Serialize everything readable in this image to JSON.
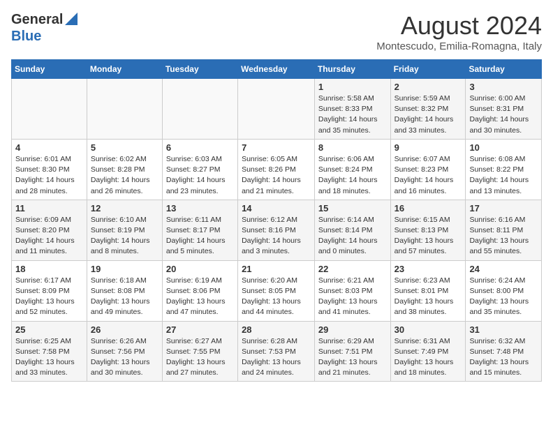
{
  "header": {
    "logo_general": "General",
    "logo_blue": "Blue",
    "month_year": "August 2024",
    "location": "Montescudo, Emilia-Romagna, Italy"
  },
  "weekdays": [
    "Sunday",
    "Monday",
    "Tuesday",
    "Wednesday",
    "Thursday",
    "Friday",
    "Saturday"
  ],
  "weeks": [
    [
      {
        "day": "",
        "info": ""
      },
      {
        "day": "",
        "info": ""
      },
      {
        "day": "",
        "info": ""
      },
      {
        "day": "",
        "info": ""
      },
      {
        "day": "1",
        "info": "Sunrise: 5:58 AM\nSunset: 8:33 PM\nDaylight: 14 hours and 35 minutes."
      },
      {
        "day": "2",
        "info": "Sunrise: 5:59 AM\nSunset: 8:32 PM\nDaylight: 14 hours and 33 minutes."
      },
      {
        "day": "3",
        "info": "Sunrise: 6:00 AM\nSunset: 8:31 PM\nDaylight: 14 hours and 30 minutes."
      }
    ],
    [
      {
        "day": "4",
        "info": "Sunrise: 6:01 AM\nSunset: 8:30 PM\nDaylight: 14 hours and 28 minutes."
      },
      {
        "day": "5",
        "info": "Sunrise: 6:02 AM\nSunset: 8:28 PM\nDaylight: 14 hours and 26 minutes."
      },
      {
        "day": "6",
        "info": "Sunrise: 6:03 AM\nSunset: 8:27 PM\nDaylight: 14 hours and 23 minutes."
      },
      {
        "day": "7",
        "info": "Sunrise: 6:05 AM\nSunset: 8:26 PM\nDaylight: 14 hours and 21 minutes."
      },
      {
        "day": "8",
        "info": "Sunrise: 6:06 AM\nSunset: 8:24 PM\nDaylight: 14 hours and 18 minutes."
      },
      {
        "day": "9",
        "info": "Sunrise: 6:07 AM\nSunset: 8:23 PM\nDaylight: 14 hours and 16 minutes."
      },
      {
        "day": "10",
        "info": "Sunrise: 6:08 AM\nSunset: 8:22 PM\nDaylight: 14 hours and 13 minutes."
      }
    ],
    [
      {
        "day": "11",
        "info": "Sunrise: 6:09 AM\nSunset: 8:20 PM\nDaylight: 14 hours and 11 minutes."
      },
      {
        "day": "12",
        "info": "Sunrise: 6:10 AM\nSunset: 8:19 PM\nDaylight: 14 hours and 8 minutes."
      },
      {
        "day": "13",
        "info": "Sunrise: 6:11 AM\nSunset: 8:17 PM\nDaylight: 14 hours and 5 minutes."
      },
      {
        "day": "14",
        "info": "Sunrise: 6:12 AM\nSunset: 8:16 PM\nDaylight: 14 hours and 3 minutes."
      },
      {
        "day": "15",
        "info": "Sunrise: 6:14 AM\nSunset: 8:14 PM\nDaylight: 14 hours and 0 minutes."
      },
      {
        "day": "16",
        "info": "Sunrise: 6:15 AM\nSunset: 8:13 PM\nDaylight: 13 hours and 57 minutes."
      },
      {
        "day": "17",
        "info": "Sunrise: 6:16 AM\nSunset: 8:11 PM\nDaylight: 13 hours and 55 minutes."
      }
    ],
    [
      {
        "day": "18",
        "info": "Sunrise: 6:17 AM\nSunset: 8:09 PM\nDaylight: 13 hours and 52 minutes."
      },
      {
        "day": "19",
        "info": "Sunrise: 6:18 AM\nSunset: 8:08 PM\nDaylight: 13 hours and 49 minutes."
      },
      {
        "day": "20",
        "info": "Sunrise: 6:19 AM\nSunset: 8:06 PM\nDaylight: 13 hours and 47 minutes."
      },
      {
        "day": "21",
        "info": "Sunrise: 6:20 AM\nSunset: 8:05 PM\nDaylight: 13 hours and 44 minutes."
      },
      {
        "day": "22",
        "info": "Sunrise: 6:21 AM\nSunset: 8:03 PM\nDaylight: 13 hours and 41 minutes."
      },
      {
        "day": "23",
        "info": "Sunrise: 6:23 AM\nSunset: 8:01 PM\nDaylight: 13 hours and 38 minutes."
      },
      {
        "day": "24",
        "info": "Sunrise: 6:24 AM\nSunset: 8:00 PM\nDaylight: 13 hours and 35 minutes."
      }
    ],
    [
      {
        "day": "25",
        "info": "Sunrise: 6:25 AM\nSunset: 7:58 PM\nDaylight: 13 hours and 33 minutes."
      },
      {
        "day": "26",
        "info": "Sunrise: 6:26 AM\nSunset: 7:56 PM\nDaylight: 13 hours and 30 minutes."
      },
      {
        "day": "27",
        "info": "Sunrise: 6:27 AM\nSunset: 7:55 PM\nDaylight: 13 hours and 27 minutes."
      },
      {
        "day": "28",
        "info": "Sunrise: 6:28 AM\nSunset: 7:53 PM\nDaylight: 13 hours and 24 minutes."
      },
      {
        "day": "29",
        "info": "Sunrise: 6:29 AM\nSunset: 7:51 PM\nDaylight: 13 hours and 21 minutes."
      },
      {
        "day": "30",
        "info": "Sunrise: 6:31 AM\nSunset: 7:49 PM\nDaylight: 13 hours and 18 minutes."
      },
      {
        "day": "31",
        "info": "Sunrise: 6:32 AM\nSunset: 7:48 PM\nDaylight: 13 hours and 15 minutes."
      }
    ]
  ]
}
